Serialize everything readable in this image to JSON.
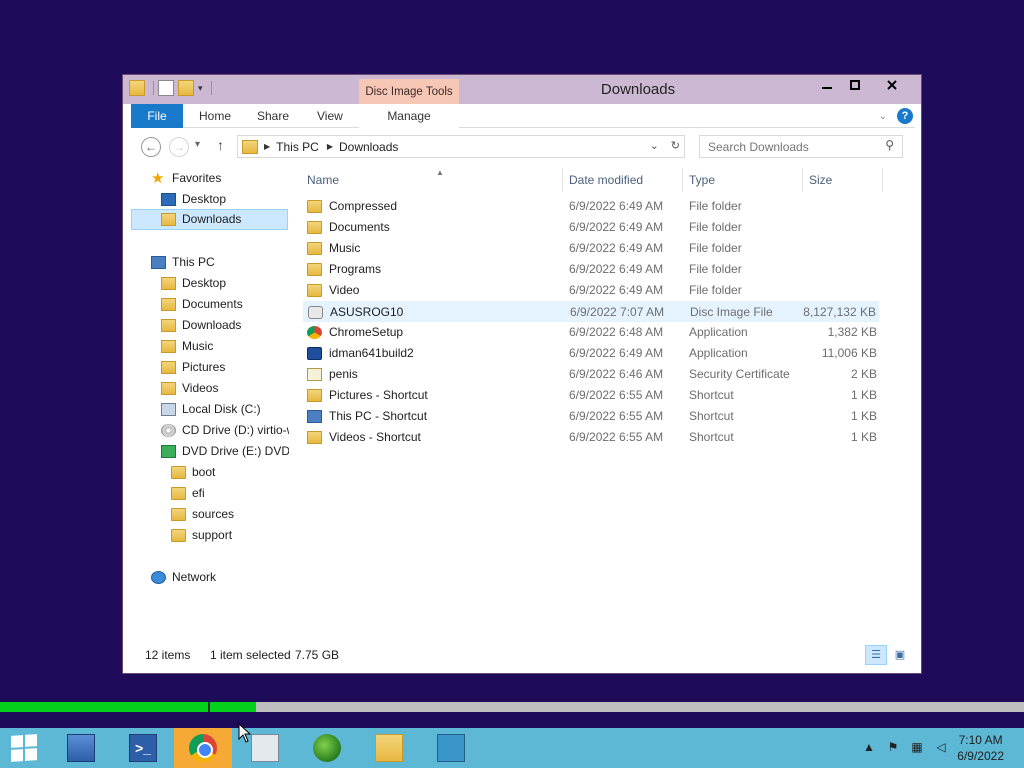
{
  "window": {
    "title": "Downloads",
    "contextual_tab_group": "Disc Image Tools",
    "minimize_icon": "minimize-icon",
    "maximize_icon": "maximize-icon",
    "close_icon": "close-icon"
  },
  "ribbon": {
    "tabs": {
      "file": "File",
      "home": "Home",
      "share": "Share",
      "view": "View",
      "manage": "Manage"
    }
  },
  "address": {
    "crumbs": [
      "This PC",
      "Downloads"
    ],
    "search_placeholder": "Search Downloads"
  },
  "nav": {
    "favorites": "Favorites",
    "fav_desktop": "Desktop",
    "fav_downloads": "Downloads",
    "this_pc": "This PC",
    "pc_desktop": "Desktop",
    "pc_documents": "Documents",
    "pc_downloads": "Downloads",
    "pc_music": "Music",
    "pc_pictures": "Pictures",
    "pc_videos": "Videos",
    "local_disk": "Local Disk (C:)",
    "cd_drive": "CD Drive (D:) virtio-w",
    "dvd_drive": "DVD Drive (E:) DVD_I",
    "boot": "boot",
    "efi": "efi",
    "sources": "sources",
    "support": "support",
    "network": "Network"
  },
  "columns": {
    "name": "Name",
    "date": "Date modified",
    "type": "Type",
    "size": "Size"
  },
  "files": [
    {
      "name": "Compressed",
      "date": "6/9/2022 6:49 AM",
      "type": "File folder",
      "size": "",
      "icon": "folder-icon"
    },
    {
      "name": "Documents",
      "date": "6/9/2022 6:49 AM",
      "type": "File folder",
      "size": "",
      "icon": "folder-icon"
    },
    {
      "name": "Music",
      "date": "6/9/2022 6:49 AM",
      "type": "File folder",
      "size": "",
      "icon": "folder-icon"
    },
    {
      "name": "Programs",
      "date": "6/9/2022 6:49 AM",
      "type": "File folder",
      "size": "",
      "icon": "folder-icon"
    },
    {
      "name": "Video",
      "date": "6/9/2022 6:49 AM",
      "type": "File folder",
      "size": "",
      "icon": "folder-icon"
    },
    {
      "name": "ASUSROG10",
      "date": "6/9/2022 7:07 AM",
      "type": "Disc Image File",
      "size": "8,127,132 KB",
      "icon": "disc-image-icon",
      "selected": true
    },
    {
      "name": "ChromeSetup",
      "date": "6/9/2022 6:48 AM",
      "type": "Application",
      "size": "1,382 KB",
      "icon": "chrome-icon"
    },
    {
      "name": "idman641build2",
      "date": "6/9/2022 6:49 AM",
      "type": "Application",
      "size": "11,006 KB",
      "icon": "idm-icon"
    },
    {
      "name": "penis",
      "date": "6/9/2022 6:46 AM",
      "type": "Security Certificate",
      "size": "2 KB",
      "icon": "certificate-icon"
    },
    {
      "name": "Pictures - Shortcut",
      "date": "6/9/2022 6:55 AM",
      "type": "Shortcut",
      "size": "1 KB",
      "icon": "shortcut-icon"
    },
    {
      "name": "This PC - Shortcut",
      "date": "6/9/2022 6:55 AM",
      "type": "Shortcut",
      "size": "1 KB",
      "icon": "pc-shortcut-icon"
    },
    {
      "name": "Videos - Shortcut",
      "date": "6/9/2022 6:55 AM",
      "type": "Shortcut",
      "size": "1 KB",
      "icon": "shortcut-icon"
    }
  ],
  "status": {
    "items": "12 items",
    "selected": "1 item selected",
    "size": "7.75 GB"
  },
  "progress": {
    "fraction": 0.25
  },
  "taskbar": {
    "apps": [
      "start-icon",
      "server-manager-icon",
      "powershell-icon",
      "chrome-icon",
      "performance-monitor-icon",
      "idm-icon",
      "file-explorer-icon",
      "download-app-icon"
    ],
    "active": "chrome-icon"
  },
  "clock": {
    "time": "7:10 AM",
    "date": "6/9/2022"
  },
  "colors": {
    "desktop": "#1e0b5a",
    "frame": "#cdb8d4",
    "accent": "#1979ca",
    "progress": "#06d11a",
    "taskbar": "#5db8d6"
  }
}
